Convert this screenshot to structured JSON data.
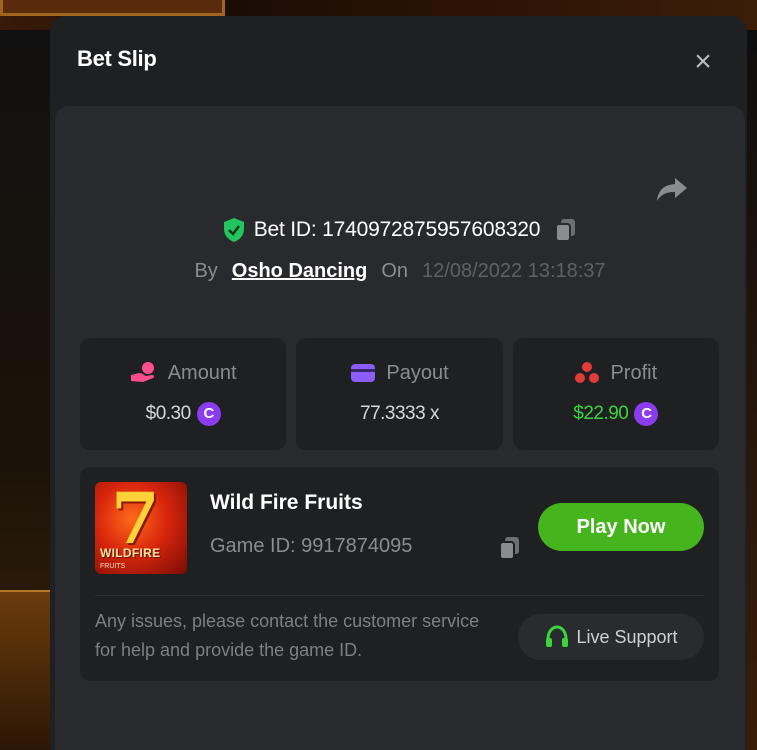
{
  "modal": {
    "title": "Bet Slip",
    "close_icon": "close-icon"
  },
  "bet": {
    "id_text": "Bet ID: 1740972875957608320",
    "by_label": "By",
    "user": "Osho Dancing",
    "on_label": "On",
    "date": "12/08/2022 13:18:37"
  },
  "stats": [
    {
      "label": "Amount",
      "value": "$0.30",
      "icon": "hand-coin-icon",
      "has_coin": true,
      "value_color": "#d6d7d9"
    },
    {
      "label": "Payout",
      "value": "77.3333 x",
      "icon": "wallet-card-icon",
      "has_coin": false,
      "value_color": "#d6d7d9"
    },
    {
      "label": "Profit",
      "value": "$22.90",
      "icon": "coins-icon",
      "has_coin": true,
      "value_color": "#3cd43c"
    }
  ],
  "coin_symbol": "C",
  "game": {
    "name": "Wild Fire Fruits",
    "id_text": "Game ID: 9917874095",
    "play_label": "Play Now",
    "thumb_title": "WILDFIRE",
    "thumb_sub": "FRUITS",
    "thumb_seven": "7"
  },
  "support": {
    "help_text": "Any issues, please contact the customer service for help and provide the game ID.",
    "button_label": "Live Support"
  },
  "colors": {
    "accent_green": "#45b41d",
    "profit_green": "#3cd43c",
    "shield_green": "#22c55e",
    "coin_purple": "#8b3cf0",
    "amount_pink": "#ff4d8d",
    "payout_purple": "#8b5cf6",
    "profit_red": "#e23b3b"
  }
}
